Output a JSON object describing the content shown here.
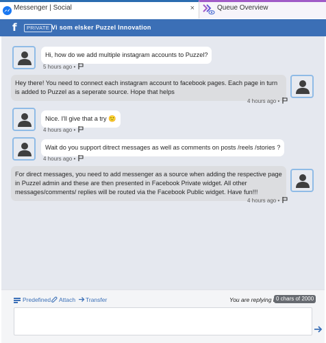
{
  "tabs": {
    "social": {
      "label": "Messenger | Social",
      "close": "×"
    },
    "queue": {
      "label": "Queue Overview"
    }
  },
  "channel": {
    "badge": "PRIVATE",
    "title": "Vi som elsker Puzzel Innovation"
  },
  "messages": [
    {
      "direction": "incoming",
      "text": "Hi, how do we add multiple instagram accounts to Puzzel?",
      "time": "5 hours ago •"
    },
    {
      "direction": "outgoing",
      "text": "Hey there! You need to connect each instagram account to facebook pages. Each page in turn is added to Puzzel as a seperate source. Hope that helps",
      "time": "4 hours ago •"
    },
    {
      "direction": "incoming",
      "text": "Nice. I'll give that a try 🙂",
      "time": "4 hours ago •"
    },
    {
      "direction": "incoming",
      "text": "Wait do you support ditrect messages as well as comments on posts /reels /stories ?",
      "time": "4 hours ago •"
    },
    {
      "direction": "outgoing",
      "text": "For direct messages, you need to add messenger as a source when adding the respective page in Puzzel admin and these are then presented in Facebook Private widget. All other messages/comments/ replies will be routed via the Facebook Public widget. Have fun!!!",
      "time": "4 hours ago •"
    }
  ],
  "composer": {
    "predefined": "Predefined",
    "attach": "Attach",
    "transfer": "Transfer",
    "replying": "You are replying to",
    "chars": "0 chars of 2000",
    "placeholder": ""
  },
  "colors": {
    "header": "#3b6fb6",
    "accent": "#3a6fb7",
    "conversation_bg": "#e5e8ef",
    "queue_tab_accent": "#a05bc7"
  },
  "icons": [
    "messenger-icon",
    "close-icon",
    "queue-overview-icon",
    "facebook-icon",
    "user-avatar-icon",
    "flag-icon",
    "predefined-list-icon",
    "paperclip-icon",
    "arrow-right-icon",
    "send-arrow-icon"
  ]
}
